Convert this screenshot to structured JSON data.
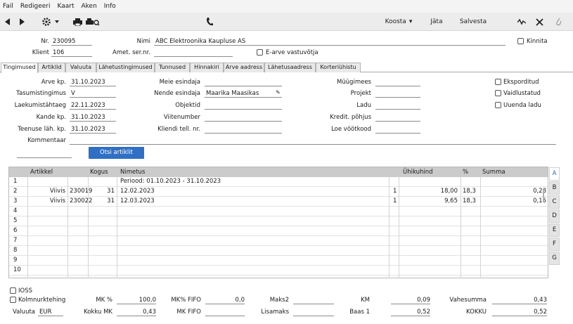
{
  "menu": [
    "Fail",
    "Redigeeri",
    "Kaart",
    "Aken",
    "Info"
  ],
  "toolbar": {
    "koosta": "Koosta",
    "jata": "Jäta",
    "salvesta": "Salvesta"
  },
  "header": {
    "nr_label": "Nr.",
    "nr_value": "230095",
    "nimi_label": "Nimi",
    "nimi_value": "ABC Elektroonika Kaupluse AS",
    "kinnita_label": "Kinnita",
    "klient_label": "Klient",
    "klient_value": "106",
    "amet_label": "Amet. ser.nr.",
    "amet_value": "",
    "earve_label": "E-arve vastuvõtja"
  },
  "tabs": [
    "Tingimused",
    "Artiklid",
    "Valuuta",
    "Lähetustingimused",
    "Tunnused",
    "Hinnakiri",
    "Arve aadress",
    "Lähetusaadress",
    "Korteriühistu"
  ],
  "form": {
    "arve_kp_label": "Arve kp.",
    "arve_kp": "31.10.2023",
    "tasumis_label": "Tasumistingimus",
    "tasumis": "V",
    "laekumis_label": "Laekumistähtaeg",
    "laekumis": "22.11.2023",
    "kande_label": "Kande kp.",
    "kande": "31.10.2023",
    "teenuse_label": "Teenuse läh. kp.",
    "teenuse": "31.10.2023",
    "kommentaar_label": "Kommentaar",
    "meie_label": "Meie esindaja",
    "meie": "",
    "nende_label": "Nende esindaja",
    "nende": "Maarika Maasikas",
    "objektid_label": "Objektid",
    "objektid": "",
    "viite_label": "Viitenumber",
    "viite": "",
    "kliendi_label": "Kliendi tell. nr.",
    "kliendi": "",
    "muugimees_label": "Müügimees",
    "projekt_label": "Projekt",
    "ladu_label": "Ladu",
    "kredit_label": "Kredit. põhjus",
    "loe_label": "Loe vöötkood",
    "eksport_label": "Eksporditud",
    "vaidlus_label": "Vaidlustatud",
    "uuenda_label": "Uuenda ladu",
    "search_button": "Otsi artiklit"
  },
  "grid": {
    "columns": {
      "artikkel": "Artikkel",
      "kogus": "Kogus",
      "nimetus": "Nimetus",
      "uhikuhind": "Ühikuhind",
      "pct": "%",
      "summa": "Summa"
    },
    "rows": [
      {
        "n": "1",
        "a1": "",
        "a2": "",
        "kogus": "",
        "nimetus": "Periood: 01.10.2023 - 31.10.2023",
        "q": "",
        "hind": "",
        "pct": "",
        "summa": ""
      },
      {
        "n": "2",
        "a1": "Viivis",
        "a2": "230019",
        "kogus": "31",
        "nimetus": "12.02.2023",
        "q": "1",
        "hind": "18,00",
        "pct": "18,3",
        "summa": "0,28"
      },
      {
        "n": "3",
        "a1": "Viivis",
        "a2": "230022",
        "kogus": "31",
        "nimetus": "12.03.2023",
        "q": "1",
        "hind": "9,65",
        "pct": "18,3",
        "summa": "0,15"
      },
      {
        "n": "4"
      },
      {
        "n": "5"
      },
      {
        "n": "6"
      },
      {
        "n": "7"
      },
      {
        "n": "8"
      },
      {
        "n": "9"
      },
      {
        "n": "10"
      }
    ],
    "side_tabs": [
      "A",
      "B",
      "C",
      "D",
      "E",
      "F",
      "G"
    ]
  },
  "footer": {
    "ioss_label": "IOSS",
    "kolm_label": "Kolmnurktehing",
    "valuuta_label": "Valuuta",
    "valuuta": "EUR",
    "mk_pct_label": "MK %",
    "mk_pct": "100,0",
    "kokku_mk_label": "Kokku MK",
    "kokku_mk": "0,43",
    "mk_fifo_pct_label": "MK% FIFO",
    "mk_fifo_pct": "0,0",
    "mk_fifo_label": "MK FIFO",
    "mk_fifo": "",
    "maks2_label": "Maks2",
    "maks2": "",
    "lisamaks_label": "Lisamaks",
    "lisamaks": "",
    "km_label": "KM",
    "km": "0,09",
    "baas_label": "Baas 1",
    "baas": "0,52",
    "vahesumma_label": "Vahesumma",
    "vahesumma": "0,43",
    "kokku_label": "KOKKU",
    "kokku": "0,52"
  }
}
